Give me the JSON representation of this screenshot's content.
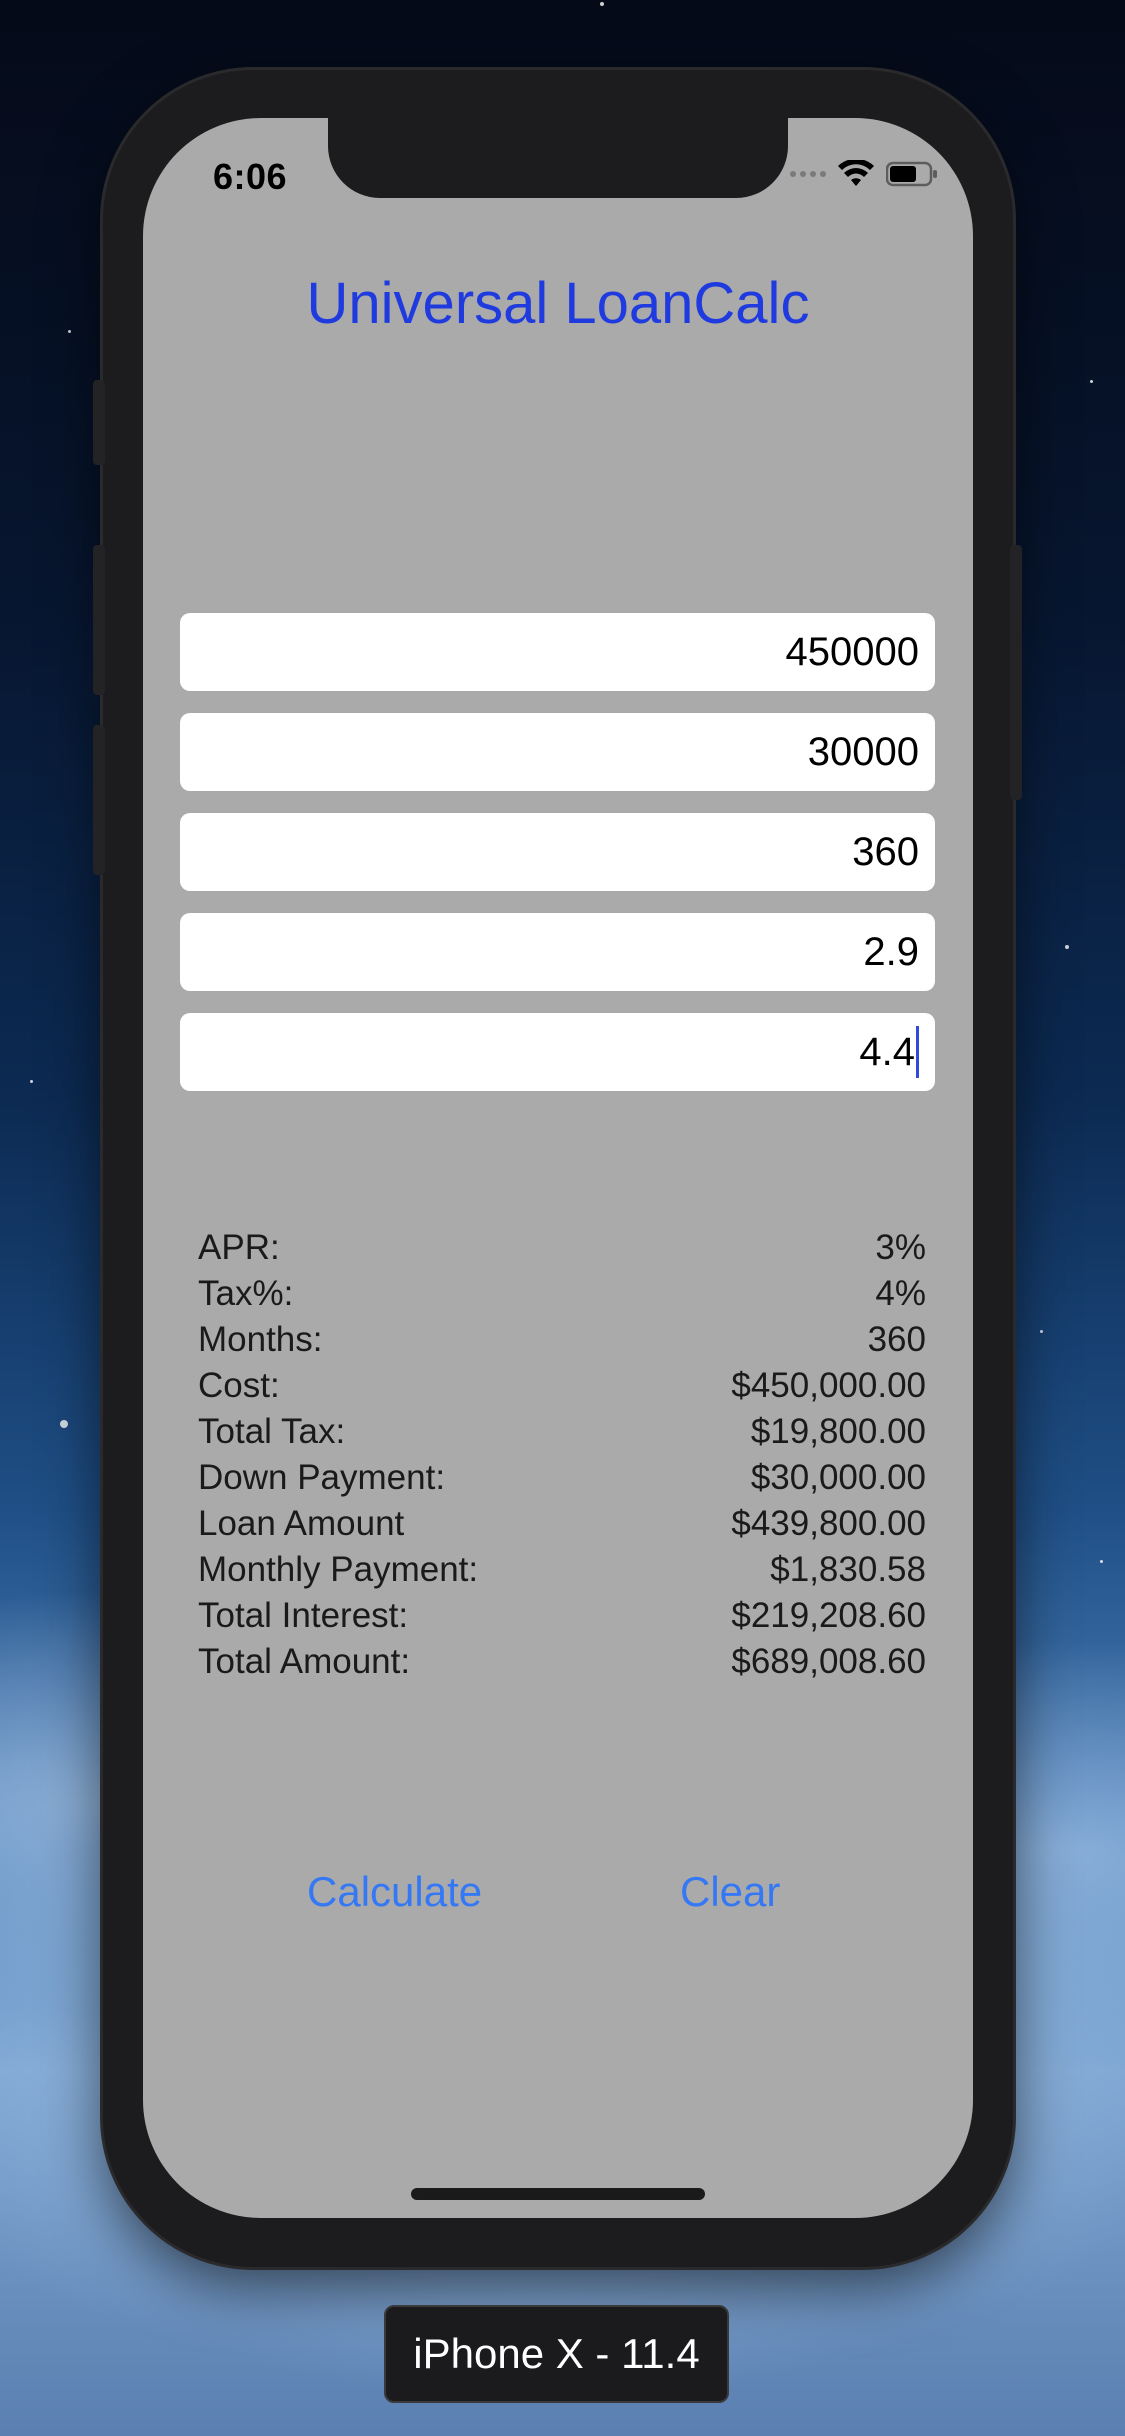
{
  "status_bar": {
    "time": "6:06",
    "icons": [
      "signal-dots-icon",
      "wifi-icon",
      "battery-icon"
    ]
  },
  "app": {
    "title": "Universal LoanCalc",
    "title_color": "#1f3be0"
  },
  "inputs": [
    {
      "value": "450000"
    },
    {
      "value": "30000"
    },
    {
      "value": "360"
    },
    {
      "value": "2.9"
    },
    {
      "value": "4.4"
    }
  ],
  "results": [
    {
      "label": "APR:",
      "value": "3%"
    },
    {
      "label": "Tax%:",
      "value": "4%"
    },
    {
      "label": "Months:",
      "value": "360"
    },
    {
      "label": "Cost:",
      "value": "$450,000.00"
    },
    {
      "label": "Total Tax:",
      "value": "$19,800.00"
    },
    {
      "label": "Down Payment:",
      "value": "$30,000.00"
    },
    {
      "label": "Loan Amount",
      "value": "$439,800.00"
    },
    {
      "label": "Monthly Payment:",
      "value": "$1,830.58"
    },
    {
      "label": "Total Interest:",
      "value": "$219,208.60"
    },
    {
      "label": "Total Amount:",
      "value": "$689,008.60"
    }
  ],
  "buttons": {
    "calculate": "Calculate",
    "clear": "Clear",
    "accent_color": "#3478f6"
  },
  "simulator": {
    "device_label": "iPhone X - 11.4"
  }
}
